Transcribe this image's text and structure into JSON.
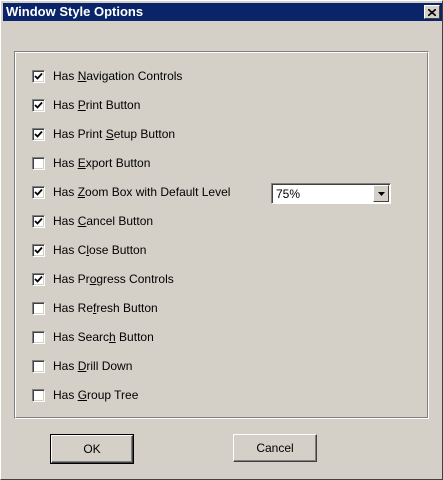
{
  "window": {
    "title": "Window Style Options",
    "close_glyph": "✕"
  },
  "options": [
    {
      "prefix": "Has ",
      "mnemonic": "N",
      "suffix": "avigation Controls",
      "checked": true
    },
    {
      "prefix": "Has ",
      "mnemonic": "P",
      "suffix": "rint Button",
      "checked": true
    },
    {
      "prefix": "Has Print ",
      "mnemonic": "S",
      "suffix": "etup Button",
      "checked": true
    },
    {
      "prefix": "Has ",
      "mnemonic": "E",
      "suffix": "xport Button",
      "checked": false
    },
    {
      "prefix": "Has ",
      "mnemonic": "Z",
      "suffix": "oom Box with Default Level",
      "checked": true
    },
    {
      "prefix": "Has ",
      "mnemonic": "C",
      "suffix": "ancel Button",
      "checked": true
    },
    {
      "prefix": "Has C",
      "mnemonic": "l",
      "suffix": "ose Button",
      "checked": true
    },
    {
      "prefix": "Has Pr",
      "mnemonic": "o",
      "suffix": "gress Controls",
      "checked": true
    },
    {
      "prefix": "Has Re",
      "mnemonic": "f",
      "suffix": "resh Button",
      "checked": false
    },
    {
      "prefix": "Has Searc",
      "mnemonic": "h",
      "suffix": " Button",
      "checked": false
    },
    {
      "prefix": "Has ",
      "mnemonic": "D",
      "suffix": "rill Down",
      "checked": false
    },
    {
      "prefix": "Has ",
      "mnemonic": "G",
      "suffix": "roup Tree",
      "checked": false
    }
  ],
  "zoom_combo": {
    "value": "75%"
  },
  "buttons": {
    "ok": "OK",
    "cancel": "Cancel"
  }
}
